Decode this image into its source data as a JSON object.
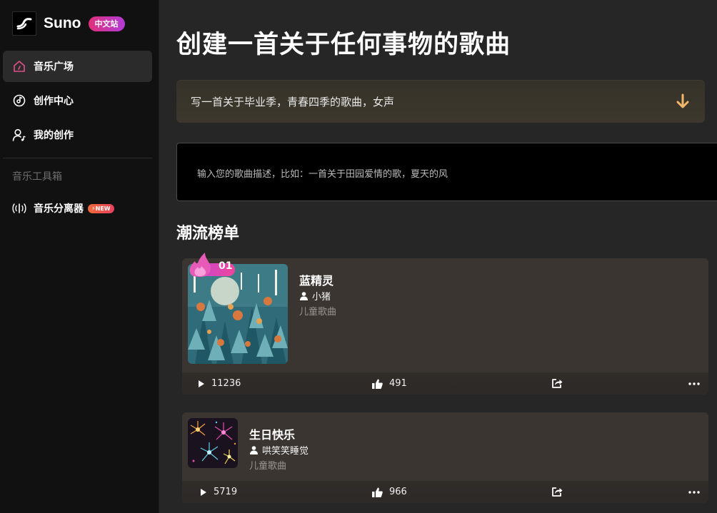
{
  "brand": {
    "name": "Suno",
    "badge": "中文站"
  },
  "sidebar": {
    "items": [
      {
        "label": "音乐广场",
        "icon": "home-icon",
        "active": true
      },
      {
        "label": "创作中心",
        "icon": "disc-icon",
        "active": false
      },
      {
        "label": "我的创作",
        "icon": "user-music-icon",
        "active": false
      }
    ],
    "toolbox_label": "音乐工具箱",
    "tools": [
      {
        "label": "音乐分离器",
        "icon": "audio-wave-icon",
        "badge": "NEW",
        "badge_icon": "bolt-icon"
      }
    ]
  },
  "main": {
    "title": "创建一首关于任何事物的歌曲",
    "prompt_example": "写一首关于毕业季，青春四季的歌曲，女声",
    "description_placeholder": "输入您的歌曲描述，比如：一首关于田园爱情的歌，夏天的风",
    "chart_title": "潮流榜单"
  },
  "songs": [
    {
      "rank": "01",
      "title": "蓝精灵",
      "author": "小猪",
      "genre": "儿童歌曲",
      "plays": "11236",
      "likes": "491"
    },
    {
      "rank": "",
      "title": "生日快乐",
      "author": "哄笑笑睡觉",
      "genre": "儿童歌曲",
      "plays": "5719",
      "likes": "966"
    }
  ],
  "colors": {
    "accent_pink": "#e0307a",
    "accent_purple": "#b23bd8",
    "arrow": "#f2b76a"
  }
}
